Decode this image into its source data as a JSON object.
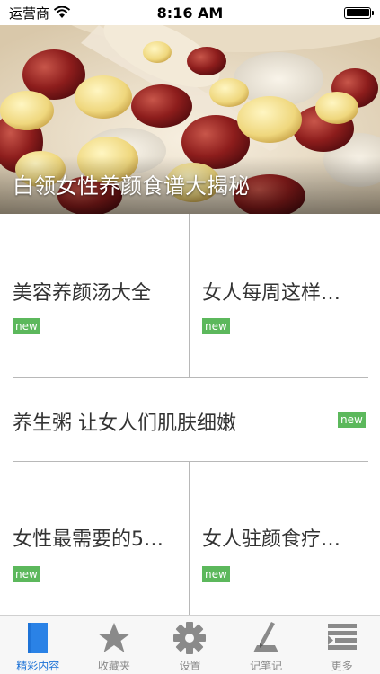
{
  "status_bar": {
    "carrier": "运营商",
    "time": "8:16 AM",
    "battery_level": 1.0
  },
  "hero": {
    "title": "白领女性养颜食谱大揭秘"
  },
  "articles": [
    {
      "title": "美容养颜汤大全",
      "badge": "new"
    },
    {
      "title": "女人每周这样…",
      "badge": "new"
    },
    {
      "title": "养生粥 让女人们肌肤细嫩",
      "badge": "new"
    },
    {
      "title": "女性最需要的5…",
      "badge": "new"
    },
    {
      "title": "女人驻颜食疗…",
      "badge": "new"
    }
  ],
  "tab_bar": {
    "active_index": 0,
    "tabs": [
      {
        "label": "精彩内容",
        "icon": "document-icon"
      },
      {
        "label": "收藏夹",
        "icon": "star-icon"
      },
      {
        "label": "设置",
        "icon": "gear-icon"
      },
      {
        "label": "记笔记",
        "icon": "pen-note-icon"
      },
      {
        "label": "更多",
        "icon": "list-more-icon"
      }
    ]
  },
  "colors": {
    "badge_green": "#5cb85c",
    "tab_active_blue": "#1e73d7",
    "tab_inactive_gray": "#8a8a8a"
  }
}
